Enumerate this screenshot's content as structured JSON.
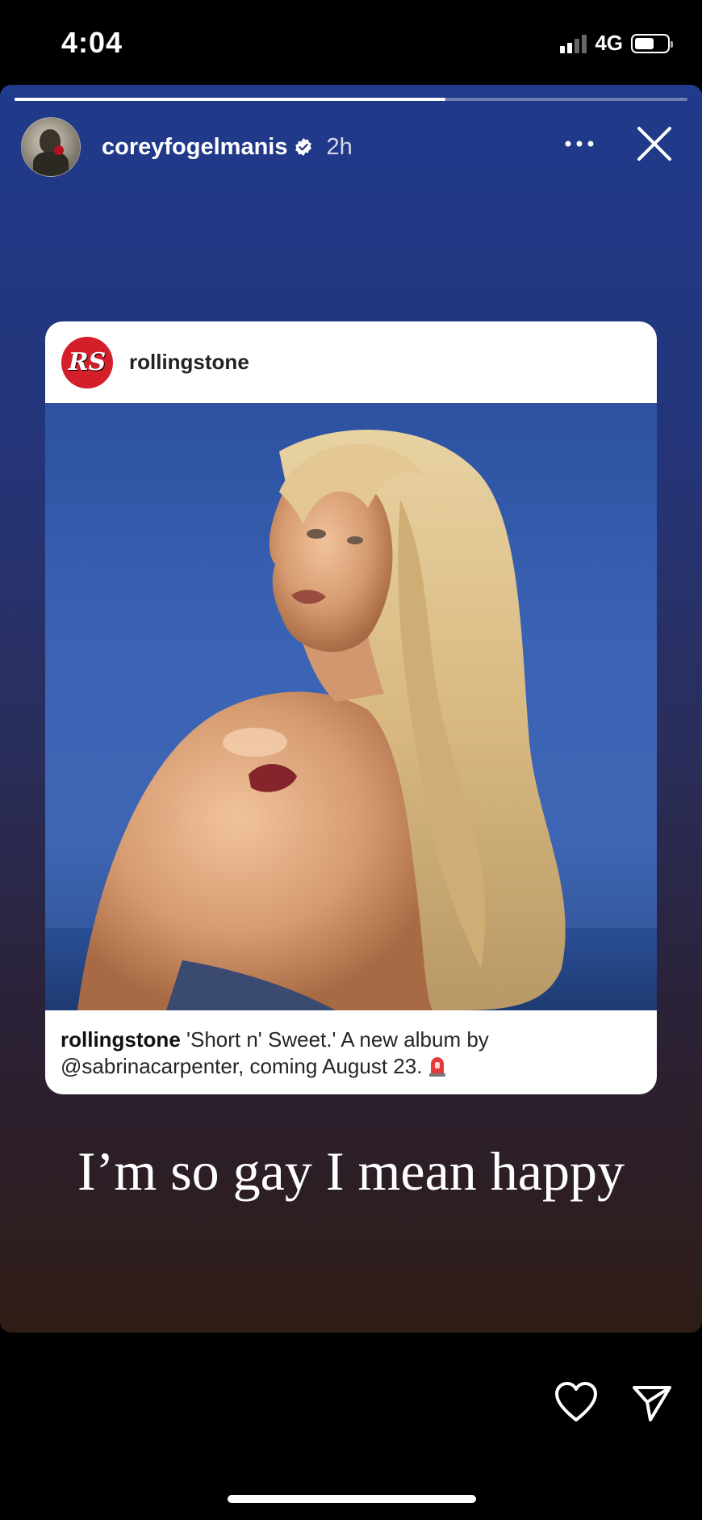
{
  "status_bar": {
    "time": "4:04",
    "network": "4G",
    "icons": [
      "signal-icon",
      "battery-icon"
    ]
  },
  "story": {
    "progress": 0.64,
    "user": {
      "username": "coreyfogelmanis",
      "verified": true,
      "posted_ago": "2h"
    },
    "menu_icon": "more-icon",
    "close_icon": "close-icon",
    "shared_post": {
      "account": "rollingstone",
      "logo_text": "RS",
      "caption_account": "rollingstone",
      "caption_text": "'Short n' Sweet.' A new album by @sabrinacarpenter, coming August 23."
    },
    "overlay_text": "I’m so gay I mean happy"
  },
  "actions": {
    "like_icon": "heart-icon",
    "share_icon": "send-icon"
  },
  "colors": {
    "story_top": "#203a8c",
    "story_bottom": "#2e1c15",
    "rs_red": "#d31f2a"
  }
}
